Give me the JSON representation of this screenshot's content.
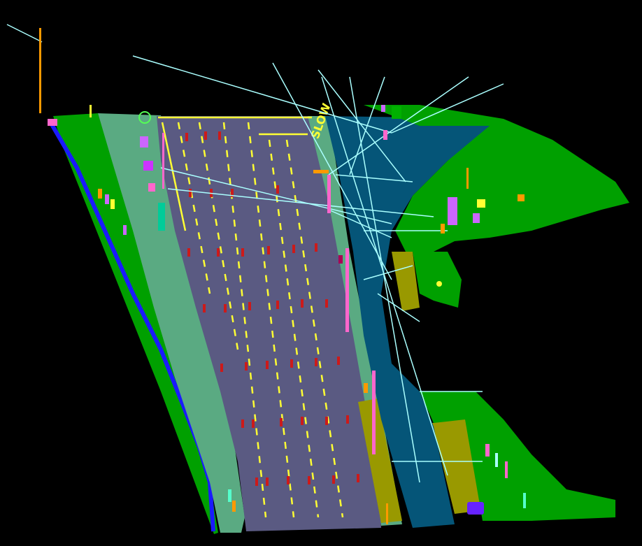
{
  "scene": {
    "kind": "semantic-segmentation point cloud of a multi-lane road",
    "background_color": "#000000"
  },
  "palette": {
    "road": "#5a5a82",
    "lane_marking": "#ffff33",
    "road_arrow": "#cc1a1a",
    "sidewalk": "#5aaa82",
    "vegetation": "#00a000",
    "terrain_teal": "#055578",
    "fence_wall": "#1a1aff",
    "pole_orange": "#ff9900",
    "pole_magenta": "#ff66cc",
    "wire": "#aaffff",
    "other_object_olive": "#999900",
    "car_violet": "#6622ff",
    "person_misc": "#cc66ff"
  },
  "road_text_marking": "SLOW"
}
